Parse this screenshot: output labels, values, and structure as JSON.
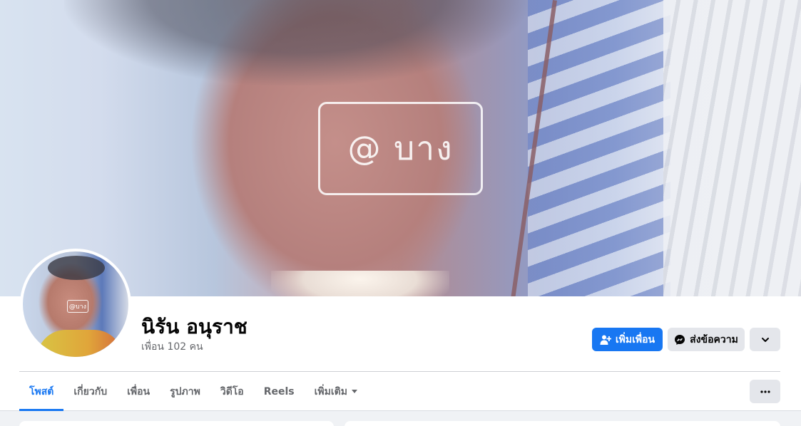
{
  "cover": {
    "watermark_text": "@ บาง",
    "avatar_watermark_text": "@บาง"
  },
  "profile": {
    "name": "นิรัน อนุราช",
    "friends_count": "เพื่อน 102 คน"
  },
  "actions": {
    "add_friend_label": "เพิ่มเพื่อน",
    "message_label": "ส่งข้อความ",
    "add_friend_icon": "add-person-icon",
    "message_icon": "messenger-icon",
    "more_icon": "chevron-down-icon"
  },
  "tabs": [
    {
      "label": "โพสต์",
      "active": true
    },
    {
      "label": "เกี่ยวกับ",
      "active": false
    },
    {
      "label": "เพื่อน",
      "active": false
    },
    {
      "label": "รูปภาพ",
      "active": false
    },
    {
      "label": "วิดีโอ",
      "active": false
    },
    {
      "label": "Reels",
      "active": false
    },
    {
      "label": "เพิ่มเติม",
      "active": false
    }
  ],
  "colors": {
    "accent": "#1877f2",
    "secondary_button": "#e4e6eb",
    "page_background": "#f0f2f5"
  }
}
